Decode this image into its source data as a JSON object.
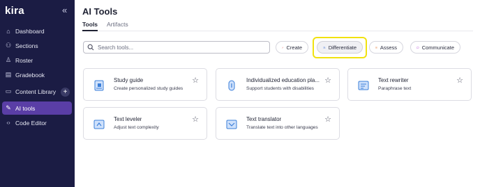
{
  "sidebar": {
    "logo": "kira",
    "collapse_glyph": "«",
    "items": [
      {
        "label": "Dashboard",
        "icon": "home-icon",
        "glyph": "⌂"
      },
      {
        "label": "Sections",
        "icon": "users-icon",
        "glyph": "⚇"
      },
      {
        "label": "Roster",
        "icon": "roster-icon",
        "glyph": "♙"
      },
      {
        "label": "Gradebook",
        "icon": "gradebook-icon",
        "glyph": "▤"
      },
      {
        "label": "Content Library",
        "icon": "book-icon",
        "glyph": "▭"
      },
      {
        "label": "AI tools",
        "icon": "ai-tools-icon",
        "glyph": "✎"
      },
      {
        "label": "Code Editor",
        "icon": "code-icon",
        "glyph": "‹›"
      }
    ],
    "add_glyph": "+",
    "active": "AI tools"
  },
  "header": {
    "title": "AI Tools"
  },
  "tabs": [
    {
      "label": "Tools"
    },
    {
      "label": "Artifacts"
    }
  ],
  "search": {
    "placeholder": "Search tools..."
  },
  "filters": [
    {
      "label": "Create",
      "icon": "pencil-icon",
      "color": "#e0453a"
    },
    {
      "label": "Differentiate",
      "icon": "differentiate-icon",
      "color": "#4a7bd8"
    },
    {
      "label": "Assess",
      "icon": "assess-icon",
      "color": "#e8752a"
    },
    {
      "label": "Communicate",
      "icon": "chat-icon",
      "color": "#b03fd6"
    }
  ],
  "tools": [
    {
      "title": "Study guide",
      "description": "Create personalized study guides",
      "icon": "study-guide-icon"
    },
    {
      "title": "Individualized education pla...",
      "description": "Support students with disabilities",
      "icon": "iep-icon"
    },
    {
      "title": "Text rewriter",
      "description": "Paraphrase text",
      "icon": "text-rewriter-icon"
    },
    {
      "title": "Text leveler",
      "description": "Adjust text complexity",
      "icon": "text-leveler-icon"
    },
    {
      "title": "Text translator",
      "description": "Translate text into other languages",
      "icon": "text-translator-icon"
    }
  ],
  "colors": {
    "sidebar": "#1b1c44",
    "active_nav": "#5a3ea6",
    "highlight": "#f1e20f",
    "tool_icon": "#3b7fd9"
  },
  "star_glyph": "☆"
}
